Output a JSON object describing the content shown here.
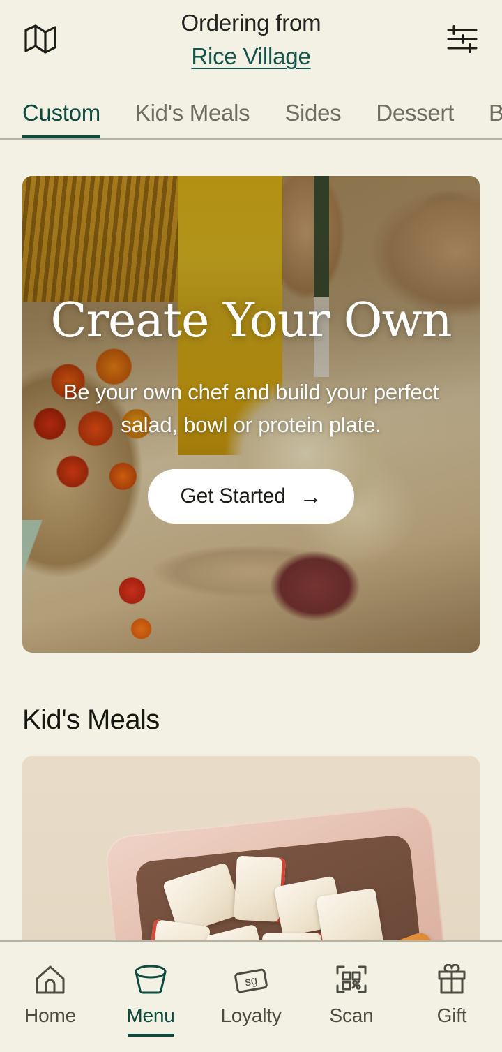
{
  "header": {
    "map_icon": "map-icon",
    "filter_icon": "filter-sliders-icon",
    "ordering_label": "Ordering from",
    "store_name": "Rice Village"
  },
  "tabs": {
    "items": [
      {
        "label": "Custom",
        "active": true
      },
      {
        "label": "Kid's Meals",
        "active": false
      },
      {
        "label": "Sides",
        "active": false
      },
      {
        "label": "Dessert",
        "active": false
      },
      {
        "label": "B",
        "active": false
      }
    ]
  },
  "hero": {
    "title": "Create Your Own",
    "subtitle": "Be your own chef and build your perfect salad, bowl or protein plate.",
    "cta_label": "Get Started",
    "cta_arrow": "→"
  },
  "sections": [
    {
      "title": "Kid's Meals"
    }
  ],
  "bottom_nav": {
    "items": [
      {
        "label": "Home",
        "icon": "home-icon",
        "active": false
      },
      {
        "label": "Menu",
        "icon": "bowl-icon",
        "active": true
      },
      {
        "label": "Loyalty",
        "icon": "sg-card-icon",
        "active": false
      },
      {
        "label": "Scan",
        "icon": "qr-code-icon",
        "active": false
      },
      {
        "label": "Gift",
        "icon": "gift-icon",
        "active": false
      }
    ],
    "loyalty_icon_text": "sg"
  },
  "colors": {
    "background": "#F2F1E4",
    "accent_green": "#0D4A40",
    "muted_text": "#6E6E64",
    "divider": "#B3B3A6"
  }
}
